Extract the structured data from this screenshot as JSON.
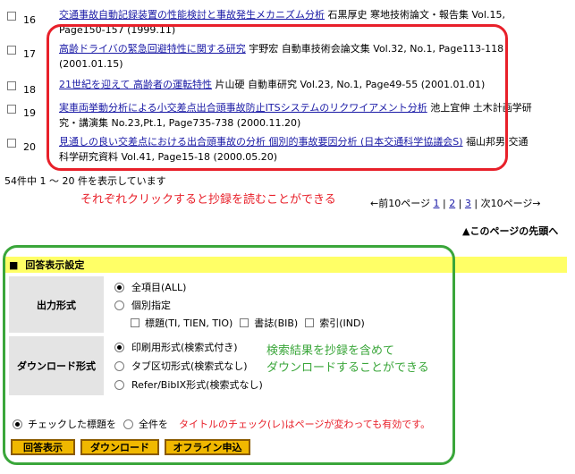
{
  "results": [
    {
      "num": "16",
      "title": "交通事故自動記録装置の性能検討と事故発生メカニズム分析",
      "line1_rest": "石黒厚史 寒地技術論文・報告集 Vol.15,",
      "line2": "Page150-157 (1999.11)"
    },
    {
      "num": "17",
      "title": "高齢ドライバの緊急回避特性に関する研究",
      "line1_rest": "宇野宏 自動車技術会論文集 Vol.32, No.1, Page113-118",
      "line2": "(2001.01.15)"
    },
    {
      "num": "18",
      "title": "21世紀を迎えて 高齢者の運転特性",
      "line1_rest": "片山硬 自動車研究 Vol.23, No.1, Page49-55 (2001.01.01)",
      "line2": ""
    },
    {
      "num": "19",
      "title": "実車両挙動分析による小交差点出合頭事故防止ITSシステムのリクワイアメント分析",
      "line1_rest": "池上宜伸 土木計画学研",
      "line2": "究・講演集 No.23,Pt.1, Page735-738 (2000.11.20)"
    },
    {
      "num": "20",
      "title": "見通しの良い交差点における出合頭事故の分析 個別的事故要因分析 (日本交通科学協議会S)",
      "line1_rest": "福山邦男 交通",
      "line2": "科学研究資料 Vol.41, Page15-18 (2000.05.20)"
    }
  ],
  "count_text": "54件中 1 ～ 20 件を表示しています",
  "annotation_click": "それぞれクリックすると抄録を読むことができる",
  "pagination": {
    "prev": "←前10ページ",
    "pages": [
      "1",
      "2",
      "3"
    ],
    "next": "次10ページ→"
  },
  "page_top_link": "▲このページの先頭へ",
  "settings": {
    "header_marker": "■",
    "header_title": "回答表示設定",
    "output_label": "出力形式",
    "opt_all": "全項目(ALL)",
    "opt_individual": "個別指定",
    "chk_title": "標題(TI, TIEN, TIO)",
    "chk_biblio": "書誌(BIB)",
    "chk_index": "索引(IND)",
    "download_label": "ダウンロード形式",
    "dl_print": "印刷用形式(検索式付き)",
    "dl_tab": "タブ区切形式(検索式なし)",
    "dl_refer": "Refer/BibIX形式(検索式なし)",
    "annotation_download_1": "検索結果を抄録を含めて",
    "annotation_download_2": "ダウンロードすることができる"
  },
  "footer": {
    "checked_titles": "チェックした標題を",
    "all_items": "全件を",
    "note": "タイトルのチェック(レ)はページが変わっても有効です。",
    "btn_show": "回答表示",
    "btn_download": "ダウンロード",
    "btn_offline": "オフライン申込"
  },
  "colors": {
    "highlight_red": "#e8202a",
    "highlight_green": "#3aa63a",
    "button_orange": "#f0b800",
    "header_yellow": "#ffff66",
    "link_blue": "#1a1aa6"
  }
}
